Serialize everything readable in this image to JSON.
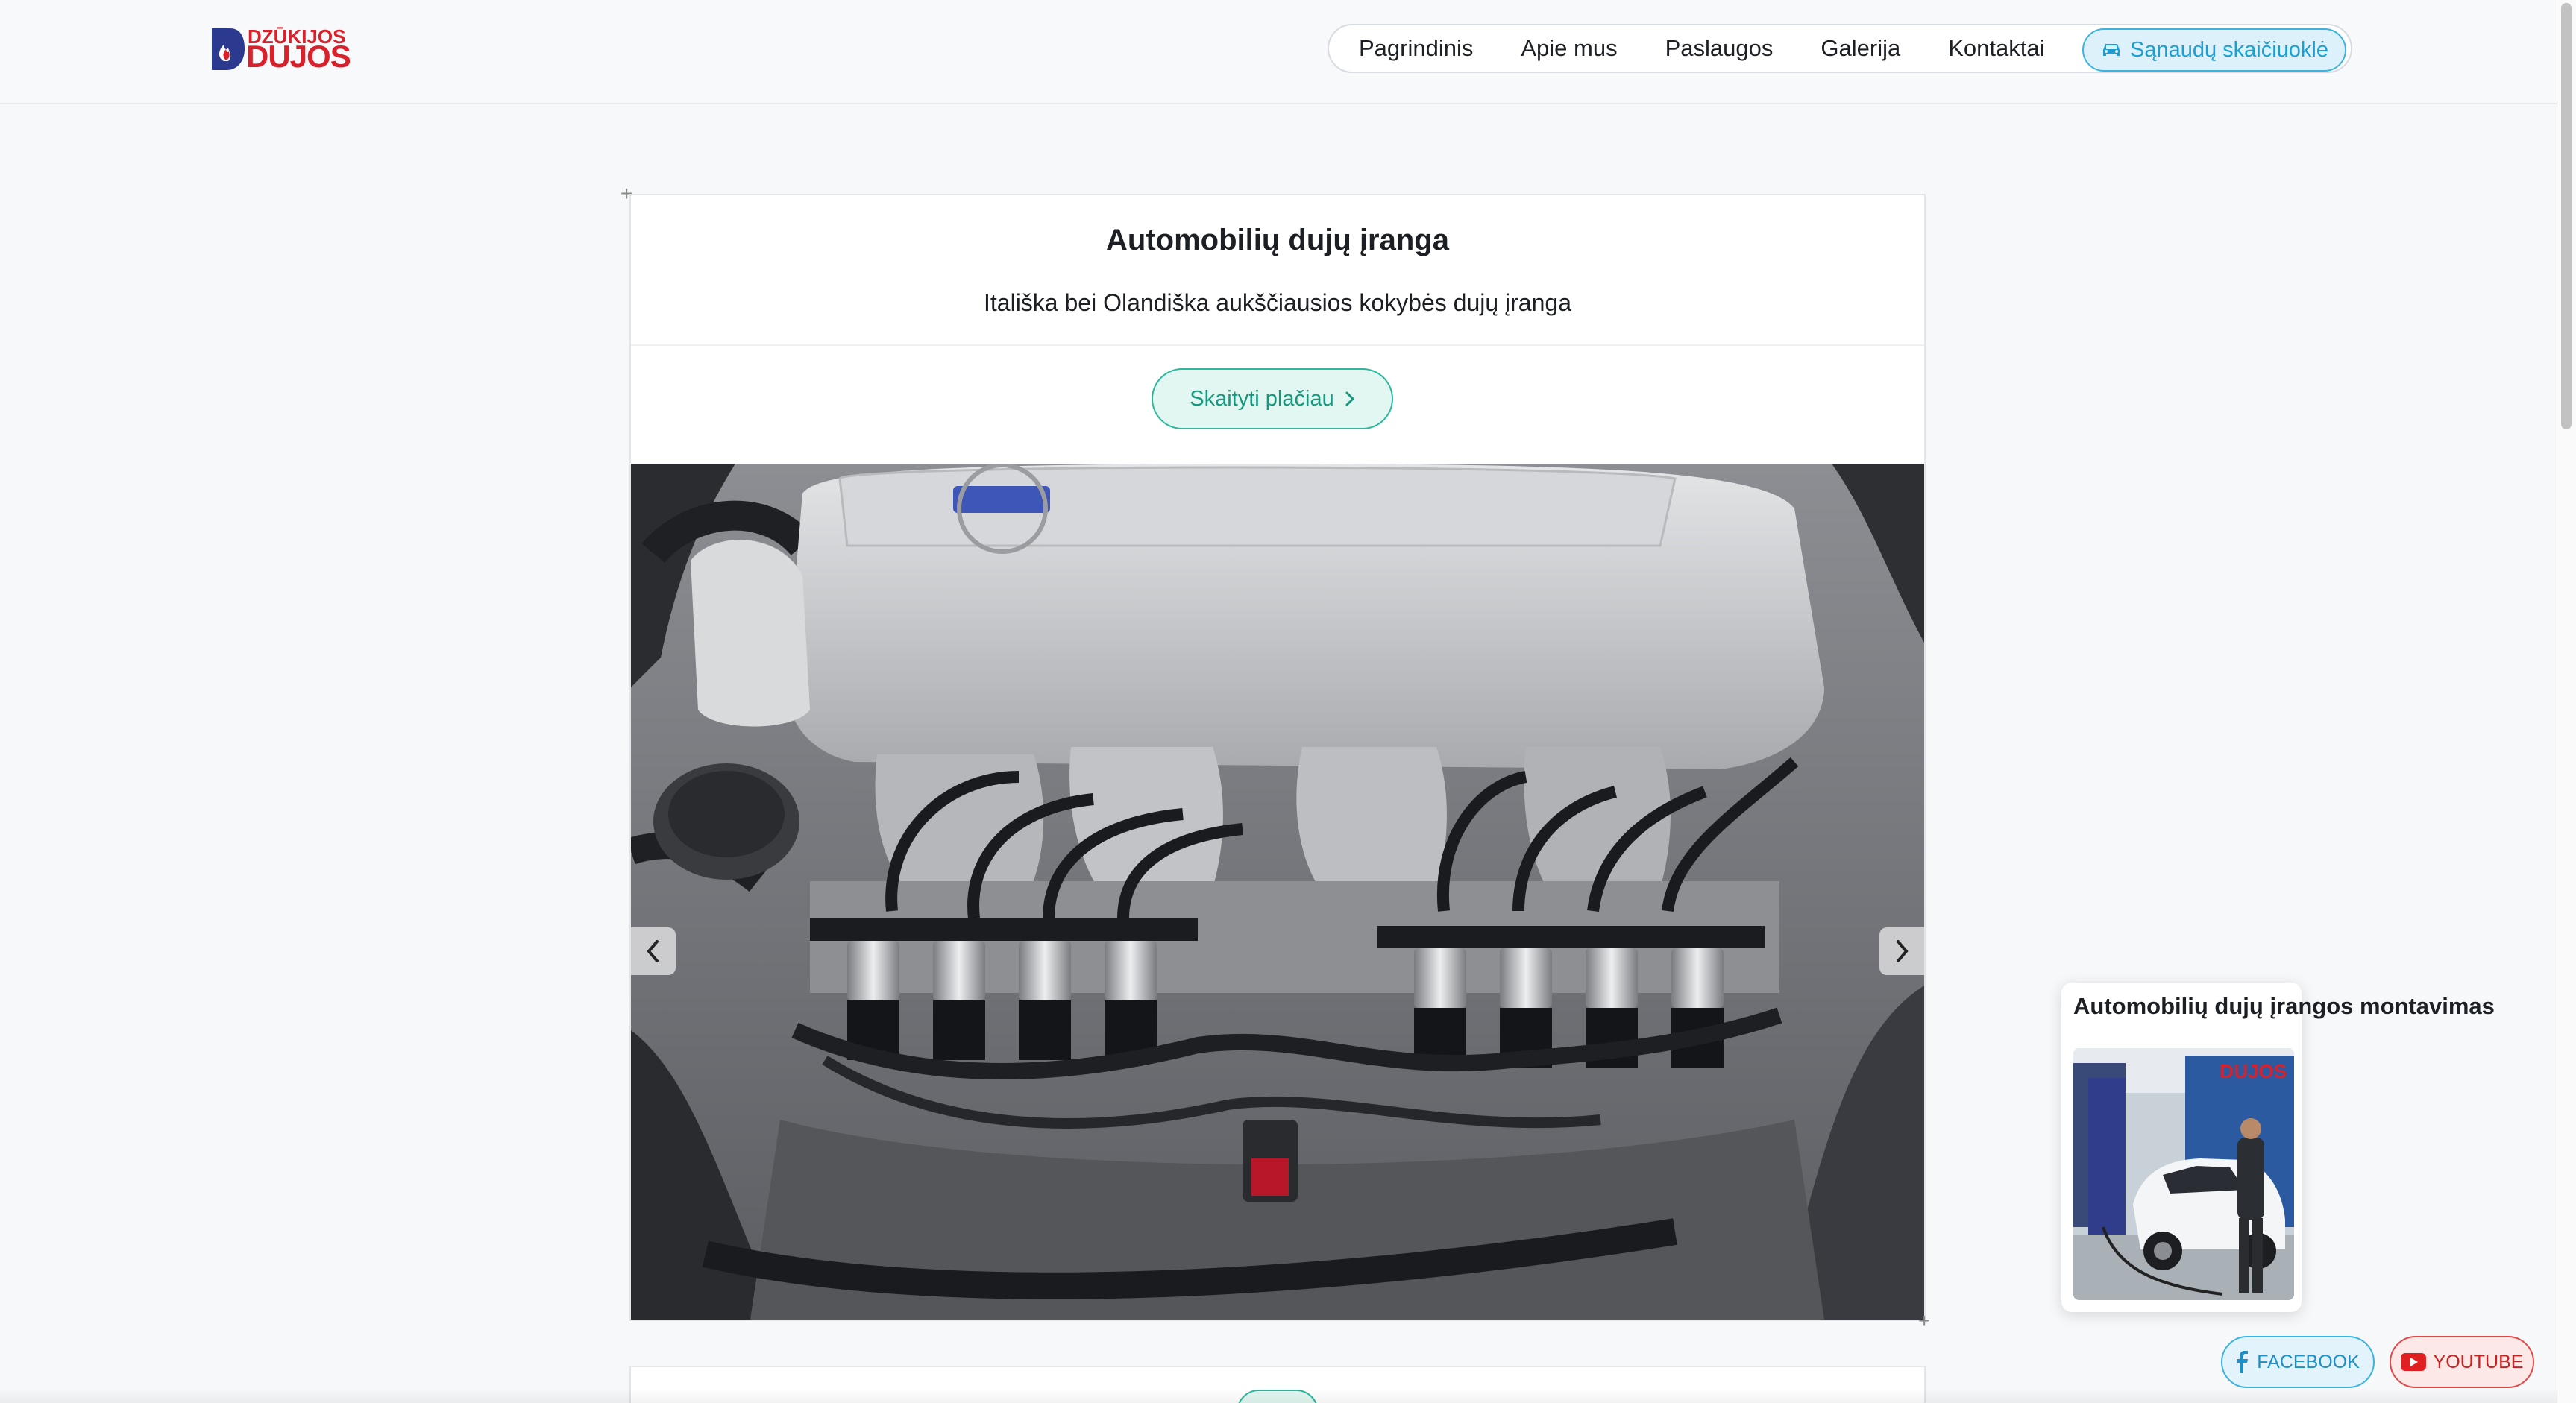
{
  "logo": {
    "top": "DZŪKIJOS",
    "bottom": "DUJOS"
  },
  "nav": {
    "items": [
      "Pagrindinis",
      "Apie mus",
      "Paslaugos",
      "Galerija",
      "Kontaktai"
    ],
    "cta": "Sąnaudų skaičiuoklė"
  },
  "card": {
    "title": "Automobilių dujų įranga",
    "subtitle": "Itališka bei Olandiška aukščiausios kokybės dujų įranga",
    "read_more": "Skaityti plačiau"
  },
  "video_widget": {
    "title": "Automobilių dujų įrangos montavimas",
    "thumb_logo": "DUJOS"
  },
  "social": {
    "facebook": "FACEBOOK",
    "youtube": "YOUTUBE"
  },
  "colors": {
    "accent_teal": "#2bb89c",
    "accent_blue": "#3bb3e0",
    "brand_red": "#d9212b",
    "brand_blue": "#2b3a8f",
    "youtube_red": "#e04848"
  },
  "icons": {
    "logo_mark": "flame-drop-icon",
    "cta_icon": "car-icon",
    "read_more_icon": "chevron-right-icon",
    "carousel_prev": "chevron-left-icon",
    "carousel_next": "chevron-right-icon",
    "facebook": "facebook-icon",
    "youtube": "youtube-icon"
  }
}
